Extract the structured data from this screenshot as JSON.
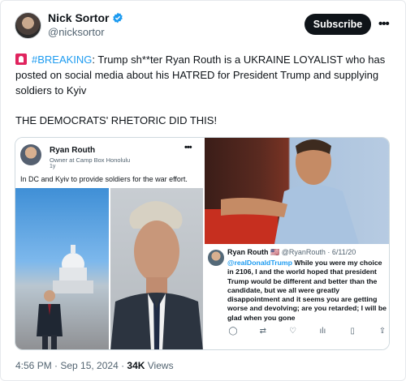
{
  "author": {
    "display_name": "Nick Sortor",
    "handle": "@nicksortor",
    "verified_icon": "verified-badge-icon"
  },
  "header": {
    "subscribe_label": "Subscribe",
    "more_icon": "more-horizontal-icon",
    "more_glyph": "•••"
  },
  "post": {
    "hashtag": "#BREAKING",
    "text_after_hashtag": ": Trump sh**ter Ryan Routh is a UKRAINE LOYALIST who has posted on social media about his HATRED for President Trump and supplying soldiers to Kyiv",
    "text_second": "THE DEMOCRATS' RHETORIC DID THIS!",
    "emoji_icon": "siren-icon"
  },
  "embedded_left": {
    "name": "Ryan Routh",
    "subtitle": "Owner at Camp Box Honolulu",
    "time": "1y",
    "more_glyph": "•••",
    "text": "In DC and Kyiv to provide soldiers for the war effort."
  },
  "embedded_right": {
    "name": "Ryan Routh",
    "flag": "🇺🇸",
    "handle_date": "@RyanRouth · 6/11/20",
    "mention": "@realDonaldTrump",
    "body": " While you were my choice in 2106, I and the world hoped that president Trump would be different and better than the candidate, but we all were greatly disappointment and it seems you are getting worse and devolving; are you retarded; I will be glad when you gone",
    "actions": [
      "comment-icon",
      "retweet-icon",
      "like-icon",
      "analytics-icon",
      "bookmark-icon",
      "share-icon"
    ],
    "action_glyphs": [
      "◯",
      "⇄",
      "♡",
      "ılı",
      "▯",
      "⇪"
    ]
  },
  "footer": {
    "timestamp": "4:56 PM · Sep 15, 2024 · ",
    "views_count": "34K",
    "views_label": " Views"
  },
  "colors": {
    "accent": "#1d9bf0",
    "text": "#0f1419",
    "muted": "#536471",
    "subscribe_bg": "#0f1419"
  }
}
